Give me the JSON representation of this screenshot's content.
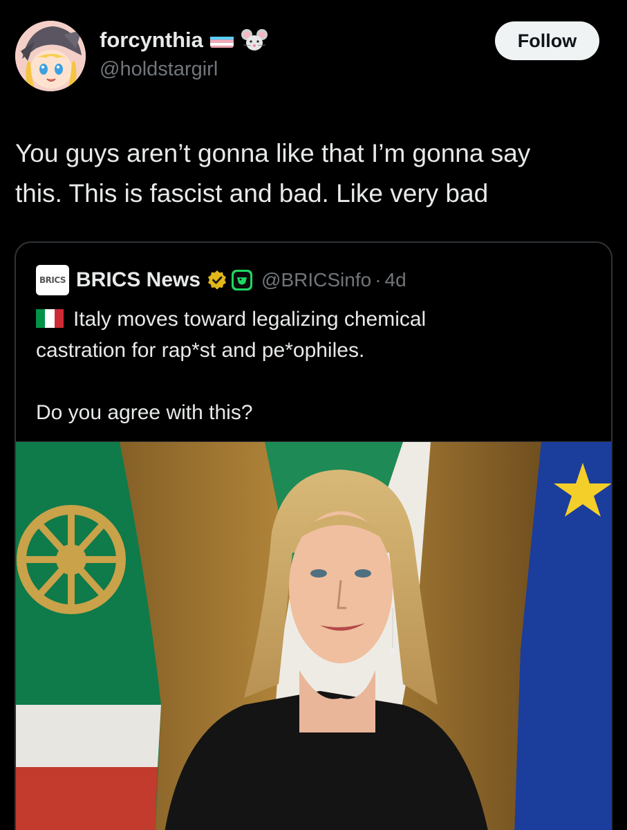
{
  "author": {
    "display_name": "forcynthia",
    "handle": "@holdstargirl",
    "flag_emoji": "transgender-flag",
    "extra_emoji": "mouse-face-emoji",
    "avatar": "anime-girl-with-hat-avatar"
  },
  "follow_button": {
    "label": "Follow"
  },
  "tweet": {
    "line1": "You guys aren’t gonna like that I’m gonna say",
    "line2": "this. This is fascist and bad. Like very bad"
  },
  "quoted": {
    "logo_text": "BRICS",
    "name": "BRICS News",
    "handle": "@BRICSinfo",
    "separator": "·",
    "time": "4d",
    "line1": "Italy moves toward legalizing chemical",
    "line2": "castration for rap*st and pe*ophiles.",
    "line3": "Do you agree with this?",
    "flag": "italy-flag"
  },
  "colors": {
    "background": "#000000",
    "text": "#e7e9ea",
    "secondary": "#71767b",
    "border": "#2f3336",
    "verified_gold": "#e2b719",
    "affiliate_green": "#1ed760"
  }
}
